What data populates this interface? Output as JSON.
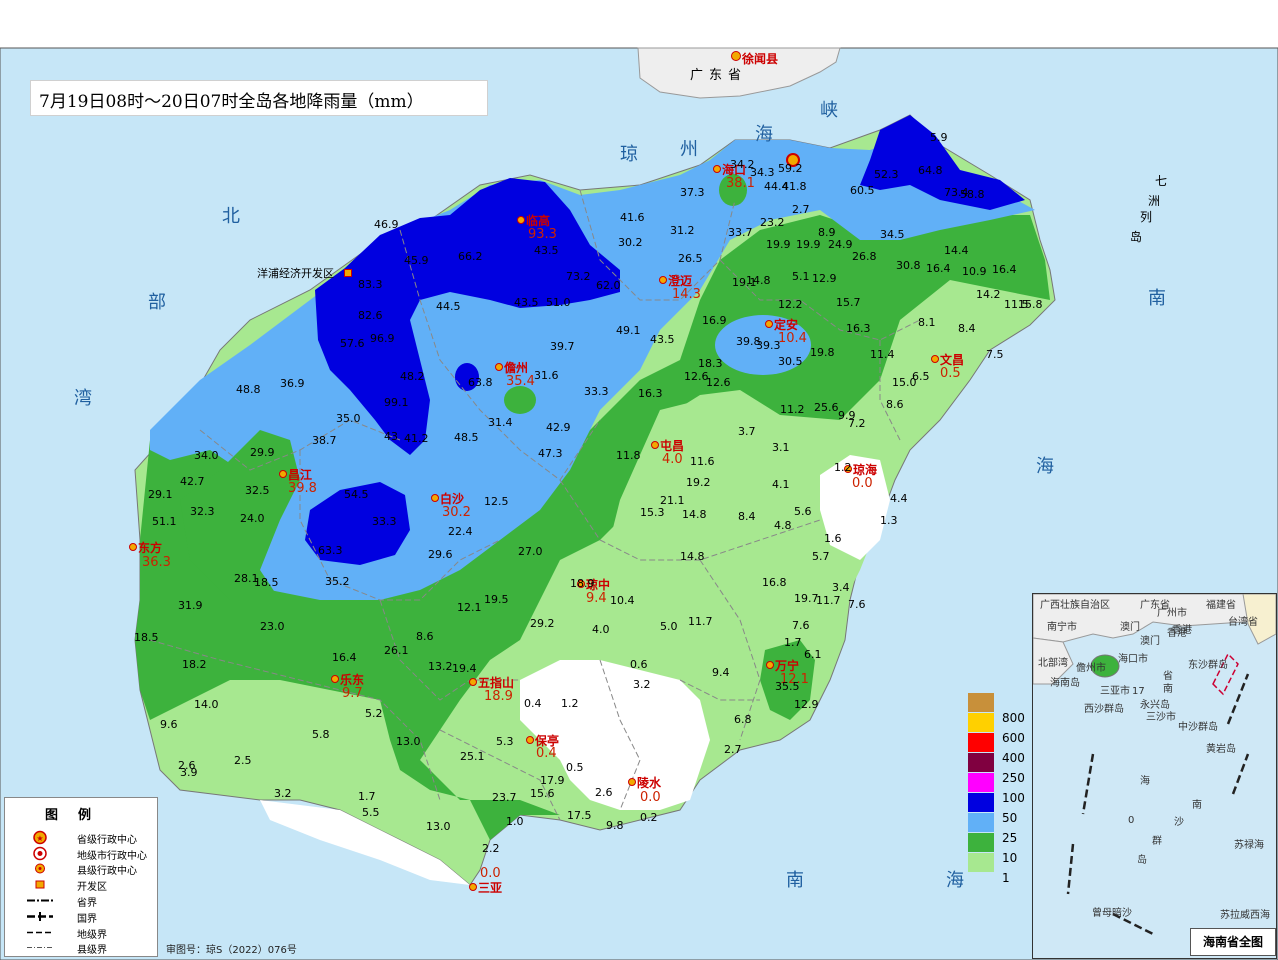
{
  "title": "7月19日08时～20日07时全岛各地降雨量（mm）",
  "colors": {
    "sea": "#c6e6f7",
    "lt10": "#ffffff",
    "1-10": "#a7e890",
    "10-25": "#3db23d",
    "25-50": "#61b0f7",
    "50-100": "#0000e0",
    "100-250": "#0000a0",
    "guangdong_land": "#eeeeee"
  },
  "mainland": {
    "label": "广东省",
    "county": "徐闻县"
  },
  "seas": {
    "strait_1": "琼",
    "strait_2": "州",
    "strait_3": "海",
    "strait_4": "峡",
    "gulf_1": "北",
    "gulf_2": "部",
    "gulf_3": "湾",
    "south_1": "南",
    "south_2": "海",
    "south_3": "南",
    "south_4": "海",
    "qizhou": [
      "七",
      "洲",
      "列",
      "岛"
    ]
  },
  "cities": [
    {
      "name": "海口",
      "value": "38.1"
    },
    {
      "name": "临高",
      "value": "93.3"
    },
    {
      "name": "澄迈",
      "value": "14.3"
    },
    {
      "name": "定安",
      "value": "10.4"
    },
    {
      "name": "文昌",
      "value": "0.5"
    },
    {
      "name": "儋州",
      "value": "35.4"
    },
    {
      "name": "屯昌",
      "value": "4.0"
    },
    {
      "name": "琼海",
      "value": "0.0"
    },
    {
      "name": "昌江",
      "value": "39.8"
    },
    {
      "name": "白沙",
      "value": "30.2"
    },
    {
      "name": "东方",
      "value": "36.3"
    },
    {
      "name": "琼中",
      "value": "9.4"
    },
    {
      "name": "万宁",
      "value": "12.1"
    },
    {
      "name": "乐东",
      "value": "9.7"
    },
    {
      "name": "五指山",
      "value": "18.9"
    },
    {
      "name": "保亭",
      "value": "0.4"
    },
    {
      "name": "陵水",
      "value": "0.0"
    },
    {
      "name": "三亚",
      "value": "0.0"
    }
  ],
  "devzone": "洋浦经济开发区",
  "stations": [
    "34.2",
    "34.3",
    "59.2",
    "44.4",
    "41.8",
    "37.3",
    "41.6",
    "31.2",
    "30.2",
    "33.7",
    "23.2",
    "2.7",
    "8.9",
    "24.9",
    "19.9",
    "19.9",
    "26.8",
    "34.5",
    "30.8",
    "14.4",
    "16.4",
    "10.9",
    "16.4",
    "14.2",
    "11.5",
    "15.8",
    "8.1",
    "8.4",
    "7.5",
    "6.5",
    "15.0",
    "8.6",
    "11.4",
    "16.3",
    "15.7",
    "19.8",
    "12.9",
    "12.2",
    "5.1",
    "19.1",
    "14.8",
    "26.5",
    "16.9",
    "12.6",
    "18.3",
    "12.6",
    "43.5",
    "49.1",
    "39.7",
    "33.3",
    "31.6",
    "42.9",
    "31.4",
    "47.3",
    "48.5",
    "16.3",
    "11.8",
    "11.6",
    "19.2",
    "21.1",
    "15.3",
    "14.8",
    "8.4",
    "4.1",
    "5.6",
    "4.8",
    "1.6",
    "5.7",
    "3.4",
    "7.6",
    "11.7",
    "19.7",
    "16.8",
    "14.8",
    "12.5",
    "22.4",
    "29.6",
    "27.0",
    "18.9",
    "10.4",
    "19.5",
    "4.0",
    "5.0",
    "11.7",
    "12.1",
    "29.2",
    "8.6",
    "13.2",
    "19.4",
    "26.1",
    "16.4",
    "18.2",
    "14.0",
    "23.0",
    "18.5",
    "31.9",
    "28.1",
    "18.5",
    "35.2",
    "33.3",
    "63.3",
    "54.5",
    "24.0",
    "32.3",
    "32.5",
    "29.9",
    "42.7",
    "34.0",
    "29.1",
    "51.1",
    "36.9",
    "48.8",
    "35.0",
    "38.7",
    "57.6",
    "96.9",
    "82.6",
    "83.3",
    "45.9",
    "46.9",
    "44.5",
    "66.2",
    "43.5",
    "43.5",
    "51.0",
    "73.2",
    "62.0",
    "9.6",
    "5.2",
    "5.8",
    "2.5",
    "2.6",
    "3.9",
    "3.2",
    "1.7",
    "5.5",
    "13.0",
    "13.0",
    "25.1",
    "5.3",
    "23.7",
    "15.6",
    "17.9",
    "1.0",
    "2.2",
    "17.5",
    "9.8",
    "0.2",
    "2.6",
    "0.5",
    "0.4",
    "1.2",
    "0.6",
    "3.2",
    "9.4",
    "6.8",
    "2.7",
    "12.9",
    "35.5",
    "6.1",
    "1.7",
    "7.6",
    "3.7",
    "3.1",
    "9.9",
    "7.2",
    "1.2",
    "4.4",
    "1.3",
    "48.2",
    "63.8",
    "99.1",
    "43",
    "41.2",
    "5.9",
    "64.8",
    "73.4",
    "58.8",
    "52.3",
    "60.5",
    "39.8",
    "39.3",
    "30.5",
    "11.2",
    "25.6"
  ],
  "legend": {
    "title": "图例",
    "items": [
      "省级行政中心",
      "地级市行政中心",
      "县级行政中心",
      "开发区",
      "省界",
      "国界",
      "地级界",
      "县级界"
    ]
  },
  "review_no": "审图号：琼S（2022）076号",
  "colorbar": [
    "800",
    "600",
    "400",
    "250",
    "100",
    "50",
    "25",
    "10",
    "1"
  ],
  "inset": {
    "title": "海南省全图",
    "labels": [
      "广西壮族自治区",
      "广东省",
      "福建省",
      "台湾省",
      "南宁市",
      "广州市",
      "香港",
      "澳门",
      "澳门",
      "香港",
      "海口市",
      "儋州市",
      "三亚市",
      "三沙市",
      "北部湾",
      "海南岛",
      "南",
      "省",
      "东沙群岛",
      "西沙群岛",
      "永兴岛",
      "中沙群岛",
      "黄岩岛",
      "海",
      "南",
      "沙",
      "群",
      "岛",
      "苏禄海",
      "曾母暗沙",
      "苏拉威西海",
      "0",
      "17"
    ]
  }
}
